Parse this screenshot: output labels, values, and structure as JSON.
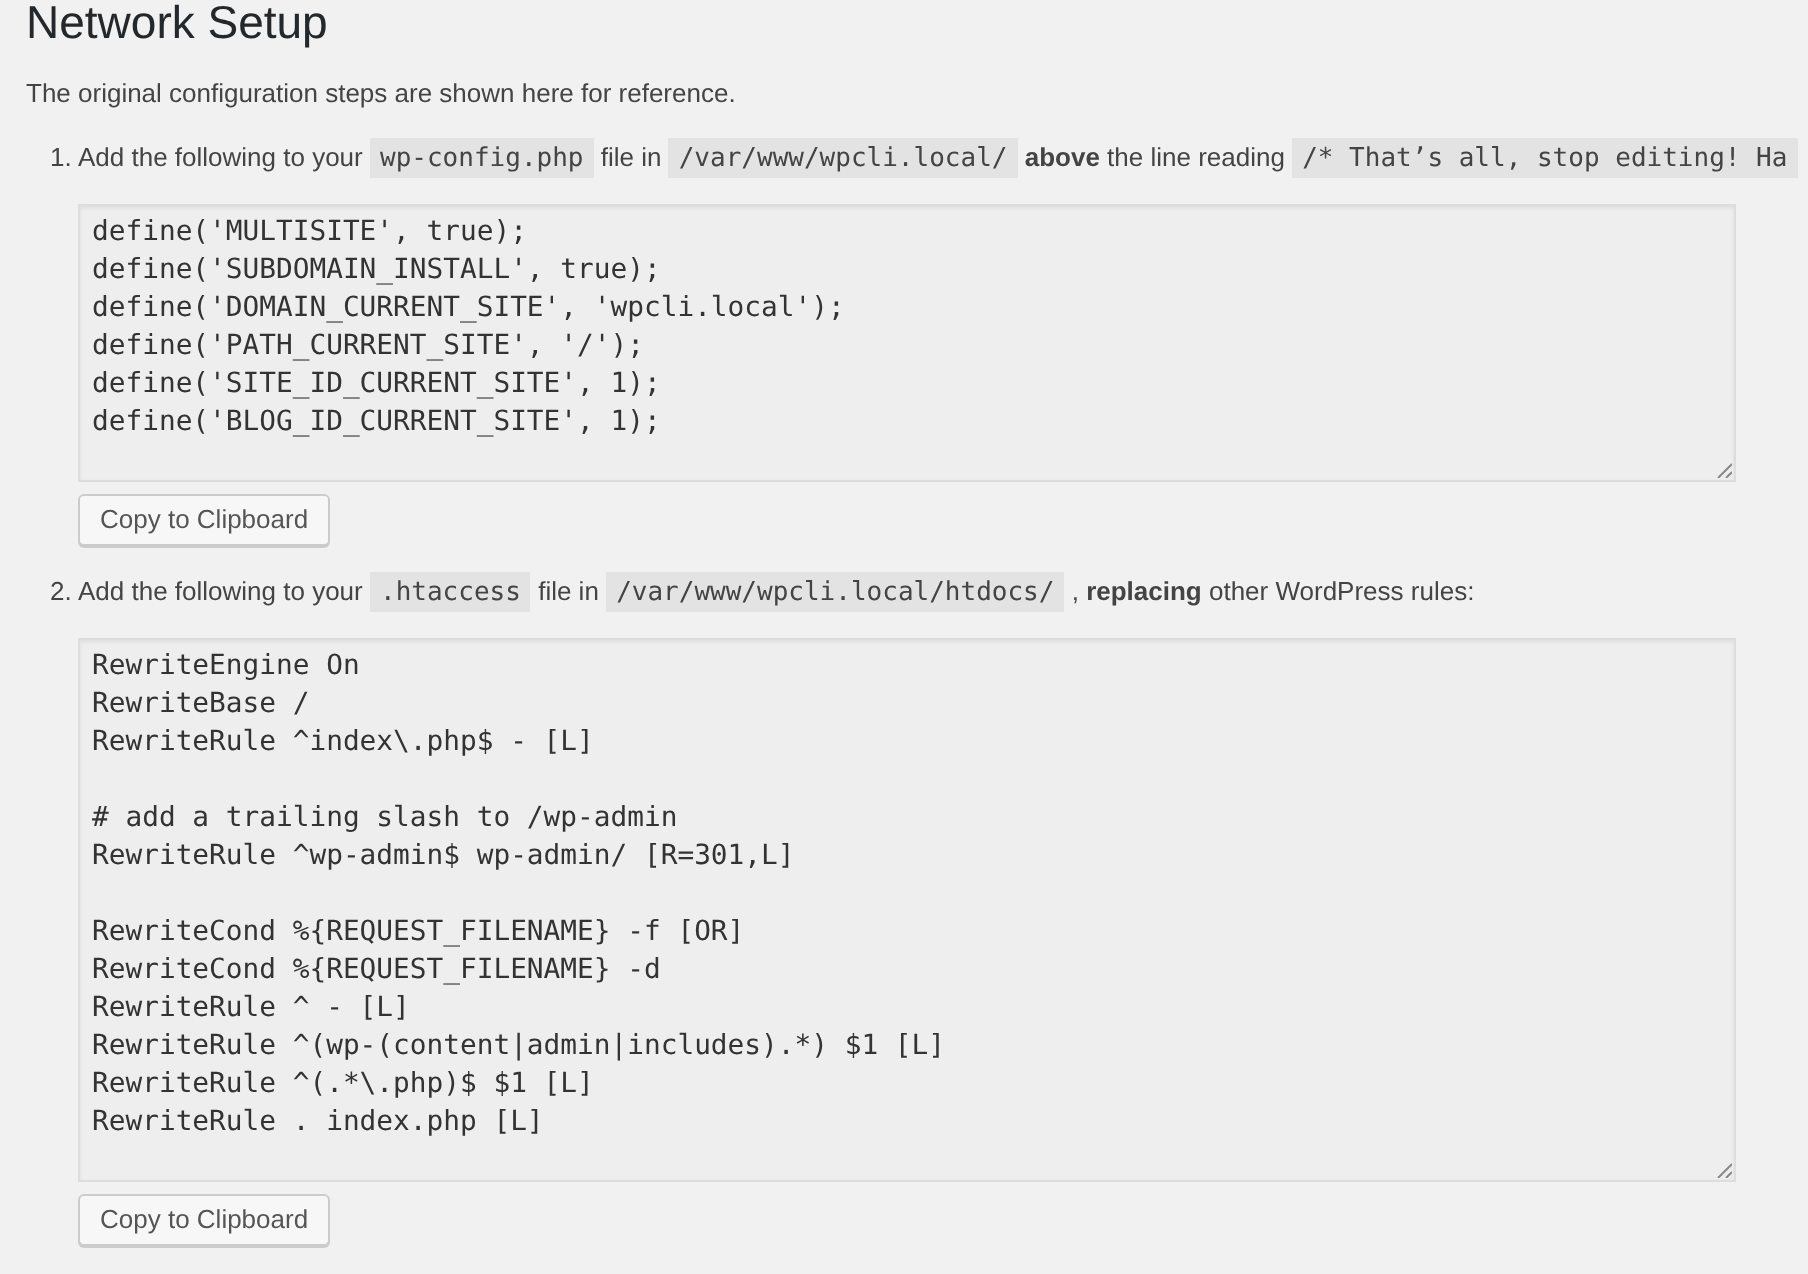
{
  "page": {
    "title": "Network Setup",
    "intro": "The original configuration steps are shown here for reference."
  },
  "steps": [
    {
      "number": "1.",
      "instruction": [
        {
          "kind": "text",
          "text": "Add the following to your"
        },
        {
          "kind": "code",
          "text": "wp-config.php"
        },
        {
          "kind": "text",
          "text": "file in"
        },
        {
          "kind": "code",
          "text": "/var/www/wpcli.local/"
        },
        {
          "kind": "text",
          "text": "**above** the line reading"
        },
        {
          "kind": "code",
          "text": "/* That’s all, stop editing! Ha"
        }
      ],
      "code": "define('MULTISITE', true);\ndefine('SUBDOMAIN_INSTALL', true);\ndefine('DOMAIN_CURRENT_SITE', 'wpcli.local');\ndefine('PATH_CURRENT_SITE', '/');\ndefine('SITE_ID_CURRENT_SITE', 1);\ndefine('BLOG_ID_CURRENT_SITE', 1);",
      "button": "Copy to Clipboard"
    },
    {
      "number": "2.",
      "instruction": [
        {
          "kind": "text",
          "text": "Add the following to your"
        },
        {
          "kind": "code",
          "text": ".htaccess"
        },
        {
          "kind": "text",
          "text": "file in"
        },
        {
          "kind": "code",
          "text": "/var/www/wpcli.local/htdocs/"
        },
        {
          "kind": "text",
          "text": ", **replacing** other WordPress rules:"
        }
      ],
      "code": "RewriteEngine On\nRewriteBase /\nRewriteRule ^index\\.php$ - [L]\n\n# add a trailing slash to /wp-admin\nRewriteRule ^wp-admin$ wp-admin/ [R=301,L]\n\nRewriteCond %{REQUEST_FILENAME} -f [OR]\nRewriteCond %{REQUEST_FILENAME} -d\nRewriteRule ^ - [L]\nRewriteRule ^(wp-(content|admin|includes).*) $1 [L]\nRewriteRule ^(.*\\.php)$ $1 [L]\nRewriteRule . index.php [L]",
      "button": "Copy to Clipboard"
    }
  ]
}
